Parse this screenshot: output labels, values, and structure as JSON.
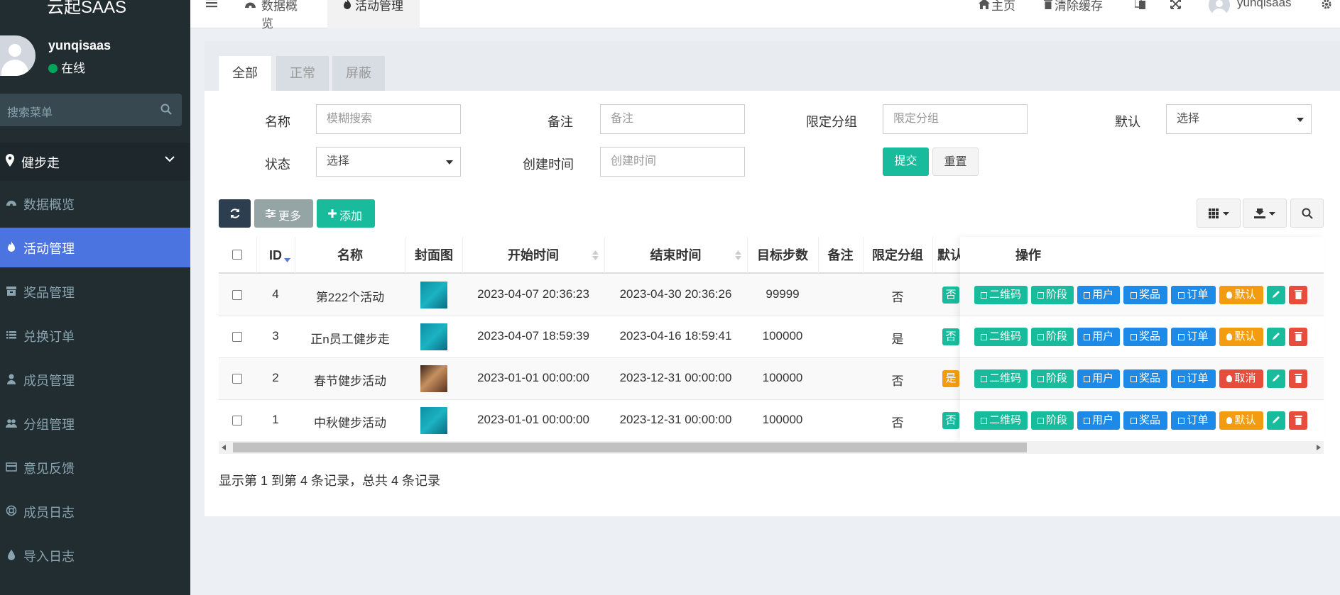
{
  "app": {
    "logo": "云起SAAS"
  },
  "user": {
    "name": "yunqisaas",
    "status": "在线"
  },
  "sidebar": {
    "search_placeholder": "搜索菜单",
    "group": "健步走",
    "items": [
      {
        "label": "数据概览",
        "icon": "dashboard-icon"
      },
      {
        "label": "活动管理",
        "icon": "flame-icon",
        "active": true
      },
      {
        "label": "奖品管理",
        "icon": "archive-icon"
      },
      {
        "label": "兑换订单",
        "icon": "list-icon"
      },
      {
        "label": "成员管理",
        "icon": "user-icon"
      },
      {
        "label": "分组管理",
        "icon": "users-icon"
      },
      {
        "label": "意见反馈",
        "icon": "credit-card-icon"
      },
      {
        "label": "成员日志",
        "icon": "life-ring-icon"
      },
      {
        "label": "导入日志",
        "icon": "drop-icon"
      }
    ]
  },
  "topbar": {
    "tabs": [
      "数据概览",
      "活动管理"
    ],
    "home": "主页",
    "clear_cache": "清除缓存",
    "username": "yunqisaas"
  },
  "tabs": [
    "全部",
    "正常",
    "屏蔽"
  ],
  "filters": {
    "name_label": "名称",
    "name_placeholder": "模糊搜索",
    "remark_label": "备注",
    "remark_placeholder": "备注",
    "group_label": "限定分组",
    "group_placeholder": "限定分组",
    "default_label": "默认",
    "default_value": "选择",
    "status_label": "状态",
    "status_value": "选择",
    "created_label": "创建时间",
    "created_placeholder": "创建时间",
    "submit": "提交",
    "reset": "重置"
  },
  "toolbar": {
    "more": "更多",
    "add": "添加"
  },
  "table": {
    "headers": [
      "ID",
      "名称",
      "封面图",
      "开始时间",
      "结束时间",
      "目标步数",
      "备注",
      "限定分组",
      "默认",
      "操作"
    ],
    "rows": [
      {
        "id": "4",
        "name": "第222个活动",
        "start": "2023-04-07 20:36:23",
        "end": "2023-04-30 20:36:26",
        "steps": "99999",
        "remark": "",
        "group": "否",
        "default": "否",
        "toggle": "默认"
      },
      {
        "id": "3",
        "name": "正n员工健步走",
        "start": "2023-04-07 18:59:39",
        "end": "2023-04-16 18:59:41",
        "steps": "100000",
        "remark": "",
        "group": "是",
        "default": "否",
        "toggle": "默认"
      },
      {
        "id": "2",
        "name": "春节健步活动",
        "start": "2023-01-01 00:00:00",
        "end": "2023-12-31 00:00:00",
        "steps": "100000",
        "remark": "",
        "group": "否",
        "default": "是",
        "toggle": "取消"
      },
      {
        "id": "1",
        "name": "中秋健步活动",
        "start": "2023-01-01 00:00:00",
        "end": "2023-12-31 00:00:00",
        "steps": "100000",
        "remark": "",
        "group": "否",
        "default": "否",
        "toggle": "默认"
      }
    ],
    "op_labels": {
      "qrcode": "二维码",
      "stage": "阶段",
      "user": "用户",
      "prize": "奖品",
      "order": "订单"
    }
  },
  "pagination": "显示第 1 到第 4 条记录，总共 4 条记录",
  "colors": {
    "sidebar": "#222d32",
    "active": "#4b74e0",
    "green": "#18bc9c",
    "blue": "#1e8ae8",
    "orange": "#f39c12",
    "red": "#e74c3c"
  }
}
